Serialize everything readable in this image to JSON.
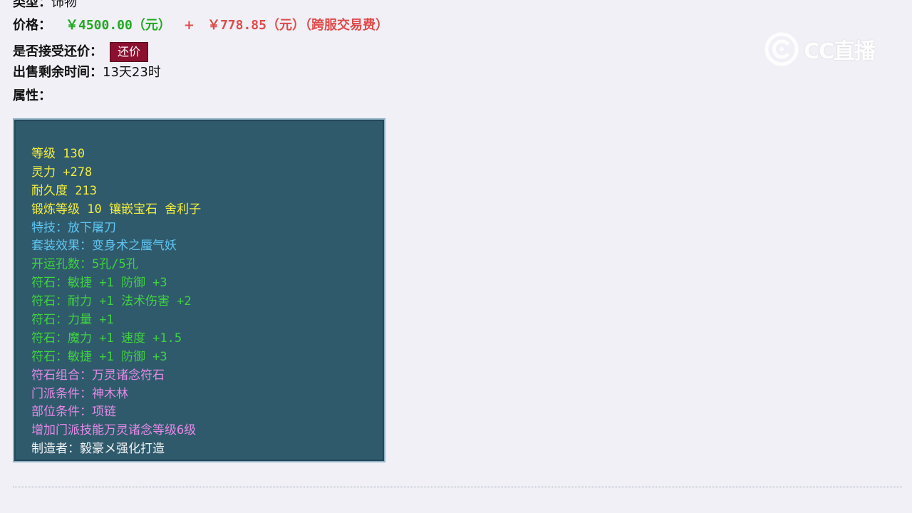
{
  "item": {
    "type_label": "类型：",
    "type_value": "饰物",
    "price_label": "价格：",
    "price_main": "￥4500.00（元）",
    "price_plus": "+",
    "price_fee": "￥778.85（元）（跨服交易费）",
    "bargain_label": "是否接受还价：",
    "bargain_button": "还价",
    "time_label": "出售剩余时间：",
    "time_value": "13天23时",
    "attr_label": "属性："
  },
  "attributes": [
    {
      "text": "等级 130",
      "color": "#f3ee3e"
    },
    {
      "text": "灵力 +278",
      "color": "#f3ee3e"
    },
    {
      "text": "耐久度 213",
      "color": "#f3ee3e"
    },
    {
      "text": "锻炼等级 10 镶嵌宝石 舍利子",
      "color": "#f3ee3e"
    },
    {
      "text": "特技：放下屠刀",
      "color": "#5fc5f2"
    },
    {
      "text": "套装效果：变身术之蜃气妖",
      "color": "#5fc5f2"
    },
    {
      "text": "开运孔数：5孔/5孔",
      "color": "#3fd23f"
    },
    {
      "text": "符石：敏捷 +1 防御 +3",
      "color": "#3fd23f"
    },
    {
      "text": "符石：耐力 +1 法术伤害 +2",
      "color": "#3fd23f"
    },
    {
      "text": "符石：力量 +1",
      "color": "#3fd23f"
    },
    {
      "text": "符石：魔力 +1 速度 +1.5",
      "color": "#3fd23f"
    },
    {
      "text": "符石：敏捷 +1 防御 +3",
      "color": "#3fd23f"
    },
    {
      "text": "符石组合：万灵诸念符石",
      "color": "#e38ae6"
    },
    {
      "text": "门派条件：神木林",
      "color": "#e38ae6"
    },
    {
      "text": "部位条件：项链",
      "color": "#e38ae6"
    },
    {
      "text": "增加门派技能万灵诸念等级6级",
      "color": "#e38ae6"
    },
    {
      "text": "制造者：毅豪メ强化打造",
      "color": "#f4f4f4"
    }
  ],
  "watermark": {
    "icon": "cc-live-logo-icon",
    "text": "CC直播"
  }
}
